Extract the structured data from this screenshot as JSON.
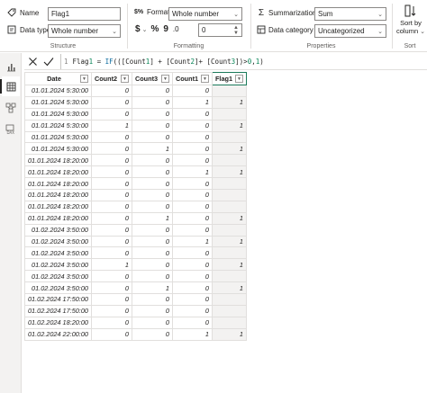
{
  "ribbon": {
    "structure": {
      "name_label": "Name",
      "name_value": "Flag1",
      "datatype_label": "Data type",
      "datatype_value": "Whole number",
      "group_label": "Structure"
    },
    "formatting": {
      "format_label": "Format",
      "format_value": "Whole number",
      "currency_symbol": "$",
      "percent_symbol": "%",
      "comma_symbol": "9",
      "decimals_value": "0",
      "group_label": "Formatting"
    },
    "properties": {
      "summarization_label": "Summarization",
      "summarization_value": "Sum",
      "category_label": "Data category",
      "category_value": "Uncategorized",
      "group_label": "Properties"
    },
    "sort": {
      "button_line1": "Sort by",
      "button_line2": "column",
      "group_label": "Sort"
    }
  },
  "formula": {
    "line_number": "1",
    "text": "Flag1 = IF(([Count1] + [Count2]+ [Count3])>0,1)"
  },
  "table": {
    "columns": [
      "Date",
      "Count2",
      "Count3",
      "Count1",
      "Flag1"
    ],
    "rows": [
      [
        "01.01.2024 5:30:00",
        "0",
        "0",
        "0",
        ""
      ],
      [
        "01.01.2024 5:30:00",
        "0",
        "0",
        "1",
        "1"
      ],
      [
        "01.01.2024 5:30:00",
        "0",
        "0",
        "0",
        ""
      ],
      [
        "01.01.2024 5:30:00",
        "1",
        "0",
        "0",
        "1"
      ],
      [
        "01.01.2024 5:30:00",
        "0",
        "0",
        "0",
        ""
      ],
      [
        "01.01.2024 5:30:00",
        "0",
        "1",
        "0",
        "1"
      ],
      [
        "01.01.2024 18:20:00",
        "0",
        "0",
        "0",
        ""
      ],
      [
        "01.01.2024 18:20:00",
        "0",
        "0",
        "1",
        "1"
      ],
      [
        "01.01.2024 18:20:00",
        "0",
        "0",
        "0",
        ""
      ],
      [
        "01.01.2024 18:20:00",
        "0",
        "0",
        "0",
        ""
      ],
      [
        "01.01.2024 18:20:00",
        "0",
        "0",
        "0",
        ""
      ],
      [
        "01.01.2024 18:20:00",
        "0",
        "1",
        "0",
        "1"
      ],
      [
        "01.02.2024 3:50:00",
        "0",
        "0",
        "0",
        ""
      ],
      [
        "01.02.2024 3:50:00",
        "0",
        "0",
        "1",
        "1"
      ],
      [
        "01.02.2024 3:50:00",
        "0",
        "0",
        "0",
        ""
      ],
      [
        "01.02.2024 3:50:00",
        "1",
        "0",
        "0",
        "1"
      ],
      [
        "01.02.2024 3:50:00",
        "0",
        "0",
        "0",
        ""
      ],
      [
        "01.02.2024 3:50:00",
        "0",
        "1",
        "0",
        "1"
      ],
      [
        "01.02.2024 17:50:00",
        "0",
        "0",
        "0",
        ""
      ],
      [
        "01.02.2024 17:50:00",
        "0",
        "0",
        "0",
        ""
      ],
      [
        "01.02.2024 18:20:00",
        "0",
        "0",
        "0",
        ""
      ],
      [
        "01.02.2024 22:00:00",
        "0",
        "0",
        "1",
        "1"
      ]
    ]
  },
  "rail": {
    "items": [
      "report-view",
      "table-view",
      "model-view",
      "dax-query-view"
    ],
    "active": "table-view"
  },
  "colors": {
    "selected_column_border": "#1b7a5a",
    "selected_column_fill": "#f3f2f1",
    "grid_line": "#e1dfdd"
  }
}
